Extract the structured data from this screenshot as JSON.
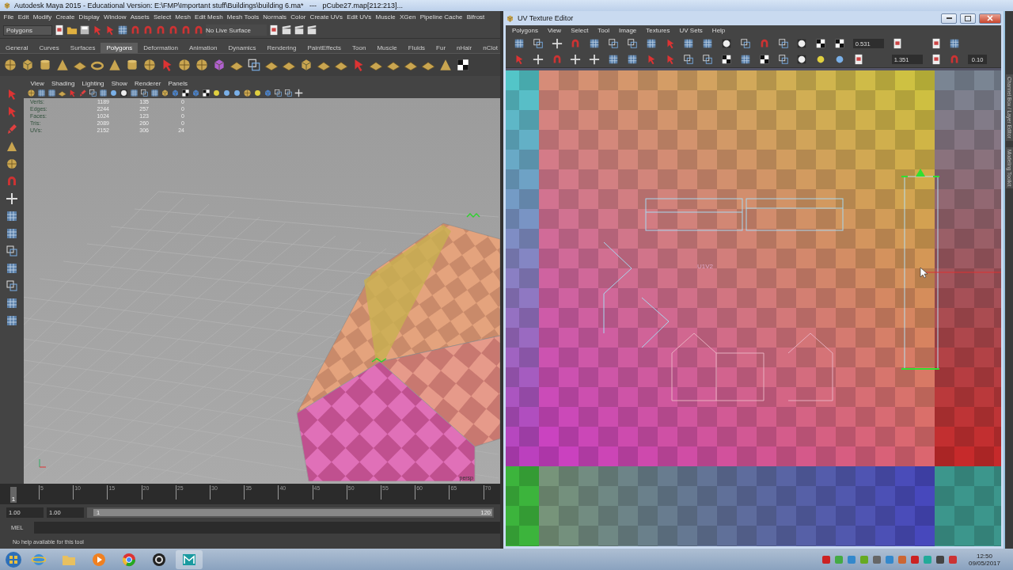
{
  "maya": {
    "title": "Autodesk Maya 2015 - Educational Version: E:\\FMP\\Important stuff\\Buildings\\building 6.ma*   ---   pCube27.map[212:213]...",
    "menus": [
      "File",
      "Edit",
      "Modify",
      "Create",
      "Display",
      "Window",
      "Assets",
      "Select",
      "Mesh",
      "Edit Mesh",
      "Mesh Tools",
      "Normals",
      "Color",
      "Create UVs",
      "Edit UVs",
      "Muscle",
      "XGen",
      "Pipeline Cache",
      "Bifrost"
    ],
    "mode_menu": "Polygons",
    "live_surface": "No Live Surface",
    "shelf_tabs": [
      {
        "label": "General",
        "selected": false
      },
      {
        "label": "Curves",
        "selected": false
      },
      {
        "label": "Surfaces",
        "selected": false
      },
      {
        "label": "Polygons",
        "selected": true
      },
      {
        "label": "Deformation",
        "selected": false
      },
      {
        "label": "Animation",
        "selected": false
      },
      {
        "label": "Dynamics",
        "selected": false
      },
      {
        "label": "Rendering",
        "selected": false
      },
      {
        "label": "PaintEffects",
        "selected": false
      },
      {
        "label": "Toon",
        "selected": false
      },
      {
        "label": "Muscle",
        "selected": false
      },
      {
        "label": "Fluids",
        "selected": false
      },
      {
        "label": "Fur",
        "selected": false
      },
      {
        "label": "nHair",
        "selected": false
      },
      {
        "label": "nClot",
        "selected": false
      }
    ],
    "panel_menus": [
      "View",
      "Shading",
      "Lighting",
      "Show",
      "Renderer",
      "Panels"
    ],
    "hud": [
      {
        "label": "Verts:",
        "values": [
          "1189",
          "135",
          "0"
        ]
      },
      {
        "label": "Edges:",
        "values": [
          "2244",
          "257",
          "0"
        ]
      },
      {
        "label": "Faces:",
        "values": [
          "1024",
          "123",
          "0"
        ]
      },
      {
        "label": "Tris:",
        "values": [
          "2089",
          "260",
          "0"
        ]
      },
      {
        "label": "UVs:",
        "values": [
          "2152",
          "306",
          "24"
        ]
      }
    ],
    "camera": "persp",
    "timeline": {
      "current": "1",
      "level": 0,
      "ticks": [
        "5",
        "10",
        "15",
        "20",
        "25",
        "30",
        "35",
        "40",
        "45",
        "50",
        "55",
        "60",
        "65",
        "70"
      ]
    },
    "range": {
      "start": "1.00",
      "anim_start": "1.00",
      "slider_start": "1",
      "slider_end": "120",
      "level": 1
    },
    "command_line": {
      "label": "MEL"
    },
    "help_line": "No help available for this tool"
  },
  "uv_editor": {
    "title": "UV Texture Editor",
    "menus": [
      "Polygons",
      "View",
      "Select",
      "Tool",
      "Image",
      "Textures",
      "UV Sets",
      "Help"
    ],
    "fields": [
      "0.531",
      "1.351"
    ],
    "step": "0.10",
    "tile_label": "U1V2"
  },
  "side_tabs": [
    "Channel Box / Layer Editor",
    "Modeling Toolkit"
  ],
  "taskbar": {
    "time": "12:50",
    "date": "09/05/2017"
  }
}
